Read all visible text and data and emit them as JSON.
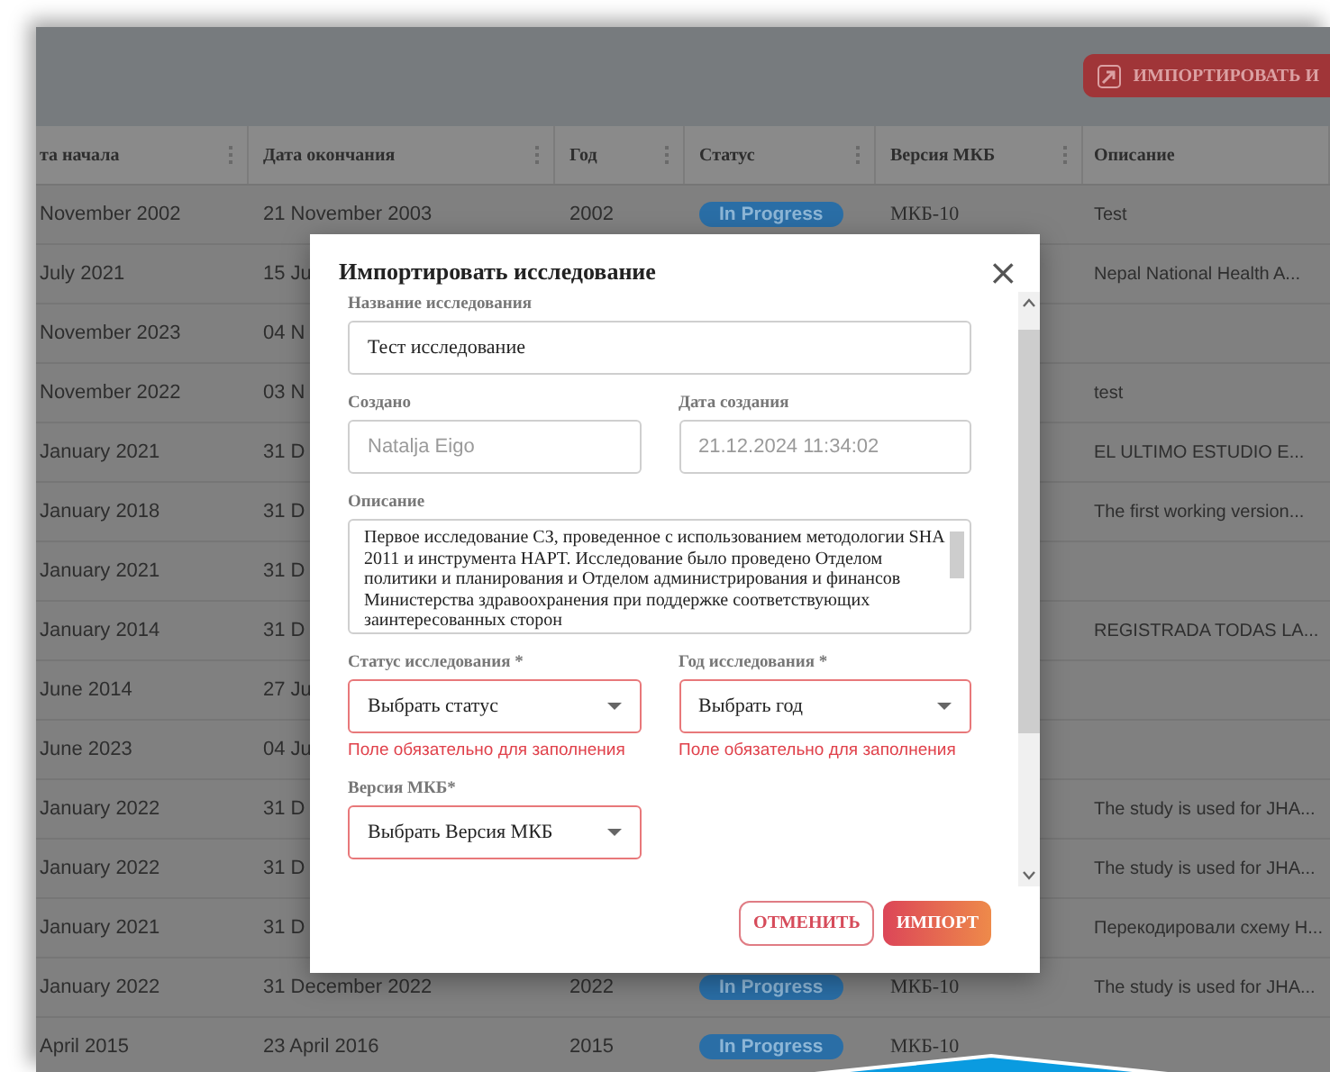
{
  "header": {
    "import_button": "ИМПОРТИРОВАТЬ И"
  },
  "table": {
    "columns": [
      "та начала",
      "Дата окончания",
      "Год",
      "Статус",
      "Версия МКБ",
      "Описание"
    ],
    "rows": [
      {
        "start": "November 2002",
        "end": "21 November 2003",
        "year": "2002",
        "status": "In Progress",
        "icd": "МКБ-10",
        "description": "Test"
      },
      {
        "start": "July 2021",
        "end": "15 Ju",
        "description": "Nepal National Health A..."
      },
      {
        "start": "November 2023",
        "end": "04 N"
      },
      {
        "start": "November 2022",
        "end": "03 N",
        "description": "test"
      },
      {
        "start": "January 2021",
        "end": "31 D",
        "description": "EL ULTIMO ESTUDIO E..."
      },
      {
        "start": "January 2018",
        "end": "31 D",
        "description": "The first working version..."
      },
      {
        "start": "January 2021",
        "end": "31 D"
      },
      {
        "start": "January 2014",
        "end": "31 D",
        "description": "REGISTRADA TODAS LA..."
      },
      {
        "start": "June 2014",
        "end": "27 Ju"
      },
      {
        "start": "June 2023",
        "end": "04 Ju"
      },
      {
        "start": "January 2022",
        "end": "31 D",
        "description": "The study is used for JHA..."
      },
      {
        "start": "January 2022",
        "end": "31 D",
        "description": "The study is used for JHA..."
      },
      {
        "start": "January 2021",
        "end": "31 D",
        "description": "Перекодировали схему H..."
      },
      {
        "start": "January 2022",
        "end": "31 December 2022",
        "year": "2022",
        "status": "In Progress",
        "icd": "МКБ-10",
        "description": "The study is used for JHA..."
      },
      {
        "start": "April 2015",
        "end": "23 April 2016",
        "year": "2015",
        "status": "In Progress",
        "icd": "МКБ-10"
      }
    ]
  },
  "dialog": {
    "title": "Импортировать исследование",
    "close": "×",
    "rows": [
      [
        {
          "kind": "text",
          "label": "Название исследования",
          "value": "Тест исследование",
          "disabled": false
        }
      ],
      [
        {
          "kind": "text",
          "label": "Создано",
          "value": "Natalja Eigo",
          "disabled": true
        },
        {
          "kind": "text",
          "label": "Дата создания",
          "value": "21.12.2024 11:34:02",
          "disabled": true
        }
      ],
      [
        {
          "kind": "textarea",
          "label": "Описание",
          "value": "Первое исследование СЗ, проведенное с использованием методологии SHA 2011 и инструмента HAPT. Исследование было проведено Отделом политики и планирования и Отделом администрирования и финансов Министерства здравоохранения при поддержке соответствующих заинтересованных сторон"
        }
      ],
      [
        {
          "kind": "select",
          "label": "Статус исследования *",
          "placeholder": "Выбрать статус",
          "invalid": true,
          "error": "Поле обязательно для заполнения"
        },
        {
          "kind": "select",
          "label": "Год исследования *",
          "placeholder": "Выбрать год",
          "invalid": true,
          "error": "Поле обязательно для заполнения"
        }
      ],
      [
        {
          "kind": "select",
          "label": "Версия МКБ*",
          "placeholder": "Выбрать Версия МКБ",
          "invalid": true
        }
      ]
    ],
    "buttons": [
      {
        "kind": "outline",
        "label": "ОТМЕНИТЬ"
      },
      {
        "kind": "primary",
        "label": "ИМПОРТ"
      }
    ]
  }
}
